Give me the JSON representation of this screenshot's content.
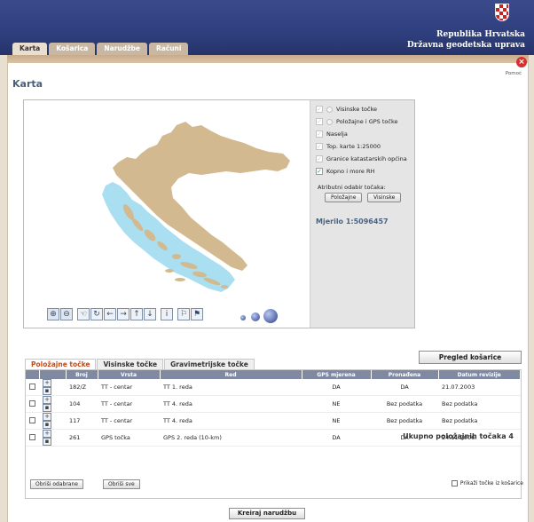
{
  "header": {
    "republic": "Republika Hrvatska",
    "agency": "Državna geodetska uprava"
  },
  "tabs": [
    {
      "label": "Karta"
    },
    {
      "label": "Košarica"
    },
    {
      "label": "Narudžbe"
    },
    {
      "label": "Računi"
    }
  ],
  "help_label": "Pomoć",
  "page_title": "Karta",
  "layers": [
    {
      "label": "Visinske točke",
      "checked": true,
      "dim": true,
      "radio": true
    },
    {
      "label": "Položajne i GPS točke",
      "checked": true,
      "dim": true,
      "radio": true
    },
    {
      "label": "Naselja",
      "checked": true,
      "dim": true,
      "radio": false
    },
    {
      "label": "Top. karte 1:25000",
      "checked": true,
      "dim": true,
      "radio": false
    },
    {
      "label": "Granice katastarskih općina",
      "checked": true,
      "dim": true,
      "radio": false
    },
    {
      "label": "Kopno i more RH",
      "checked": true,
      "dim": false,
      "radio": false
    }
  ],
  "attribute_label": "Atributni odabir točaka:",
  "attr_buttons": {
    "polozajne": "Položajne",
    "visinske": "Visinske"
  },
  "scale_label": "Mjerilo 1:5096457",
  "map_colors": {
    "land": "#d2b98f",
    "sea": "#a9dff1"
  },
  "preview_cart": "Pregled košarice",
  "point_tabs": [
    {
      "label": "Položajne točke",
      "active": true
    },
    {
      "label": "Visinske točke",
      "active": false
    },
    {
      "label": "Gravimetrijske točke",
      "active": false
    }
  ],
  "table": {
    "headers": [
      "",
      "",
      "Broj",
      "Vrsta",
      "Red",
      "GPS mjerena",
      "Pronađena",
      "Datum revizije"
    ],
    "rows": [
      {
        "broj": "182/Z",
        "vrsta": "TT - centar",
        "red": "TT 1. reda",
        "gps": "DA",
        "pronadena": "DA",
        "datum": "21.07.2003"
      },
      {
        "broj": "104",
        "vrsta": "TT - centar",
        "red": "TT 4. reda",
        "gps": "NE",
        "pronadena": "Bez podatka",
        "datum": "Bez podatka"
      },
      {
        "broj": "117",
        "vrsta": "TT - centar",
        "red": "TT 4. reda",
        "gps": "NE",
        "pronadena": "Bez podatka",
        "datum": "Bez podatka"
      },
      {
        "broj": "261",
        "vrsta": "GPS točka",
        "red": "GPS 2. reda (10-km)",
        "gps": "DA",
        "pronadena": "DA",
        "datum": "24.11.2006."
      }
    ]
  },
  "total_label": "Ukupno položajnih točaka 4",
  "buttons": {
    "remove_selected": "Obriši odabrane",
    "remove_all": "Obriši sve",
    "create_order": "Kreiraj narudžbu"
  },
  "show_cart_points": "Prikaži točke iz košarice"
}
